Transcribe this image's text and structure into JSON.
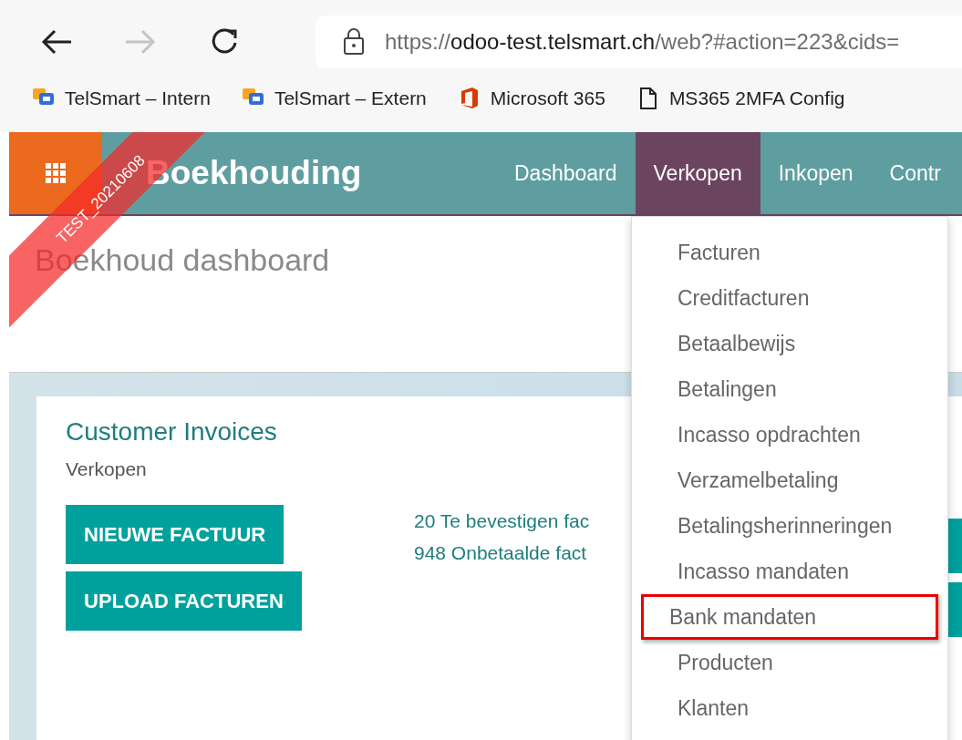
{
  "browser": {
    "back": {
      "disabled": false
    },
    "forward": {
      "disabled": true
    },
    "url": {
      "scheme": "https://",
      "host": "odoo-test.telsmart.ch",
      "path": "/web?#action=223&cids="
    }
  },
  "bookmarks": [
    {
      "kind": "teams",
      "label": "TelSmart – Intern"
    },
    {
      "kind": "teams",
      "label": "TelSmart – Extern"
    },
    {
      "kind": "office",
      "label": "Microsoft 365"
    },
    {
      "kind": "page",
      "label": "MS365 2MFA Config"
    }
  ],
  "navbar": {
    "app_name": "Boekhouding",
    "menu": [
      {
        "label": "Dashboard",
        "selected": false
      },
      {
        "label": "Verkopen",
        "selected": true
      },
      {
        "label": "Inkopen",
        "selected": false
      },
      {
        "label": "Contr",
        "selected": false
      }
    ]
  },
  "ribbon": "TEST_20210608",
  "page_title": "Boekhoud dashboard",
  "cards": [
    {
      "title": "Customer Invoices",
      "subtitle": "Verkopen",
      "buttons": [
        "NIEUWE FACTUUR",
        "UPLOAD FACTUREN"
      ],
      "links": [
        "20 Te bevestigen fac",
        "948 Onbetaalde fact"
      ]
    }
  ],
  "dropdown": {
    "items": [
      {
        "label": "Facturen",
        "highlighted": false
      },
      {
        "label": "Creditfacturen",
        "highlighted": false
      },
      {
        "label": "Betaalbewijs",
        "highlighted": false
      },
      {
        "label": "Betalingen",
        "highlighted": false
      },
      {
        "label": "Incasso opdrachten",
        "highlighted": false
      },
      {
        "label": "Verzamelbetaling",
        "highlighted": false
      },
      {
        "label": "Betalingsherinneringen",
        "highlighted": false
      },
      {
        "label": "Incasso mandaten",
        "highlighted": false
      },
      {
        "label": "Bank mandaten",
        "highlighted": true
      },
      {
        "label": "Producten",
        "highlighted": false
      },
      {
        "label": "Klanten",
        "highlighted": false
      }
    ]
  }
}
